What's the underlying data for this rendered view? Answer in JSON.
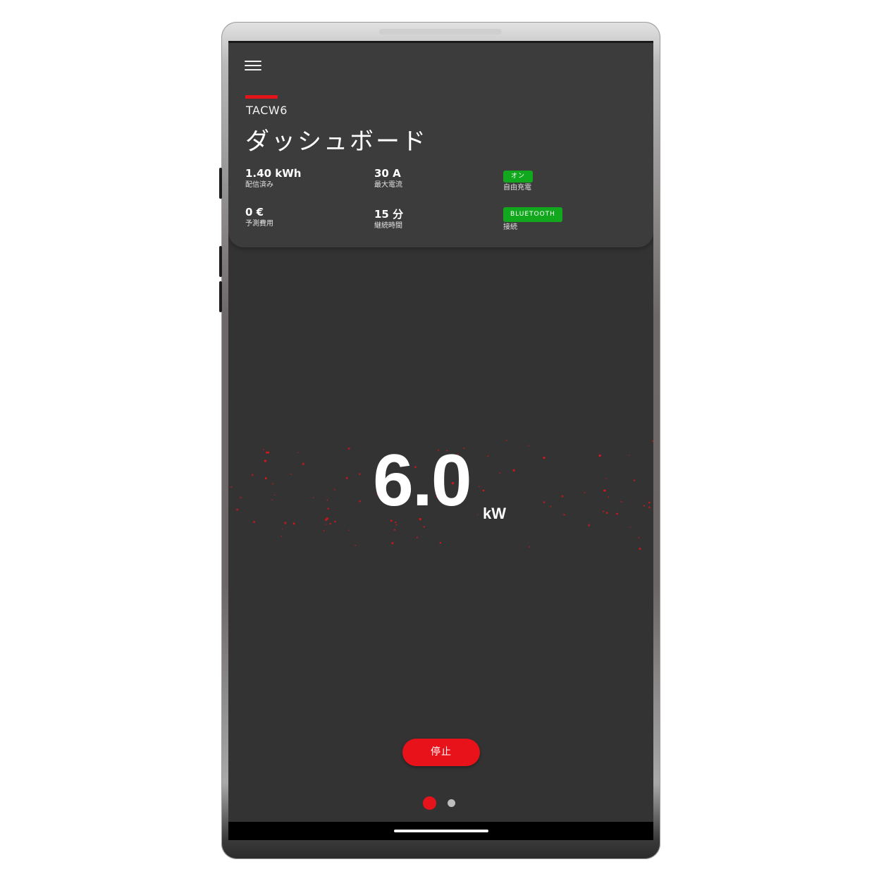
{
  "colors": {
    "accent": "#e5141b",
    "status_green": "#12a81d",
    "screen_bg": "#333333",
    "card_bg": "#3c3c3c",
    "particle": "#e0141b",
    "dot_inactive": "#bdbdbd"
  },
  "header": {
    "menu_icon": "hamburger-menu-icon",
    "device_name": "TACW6",
    "title": "ダッシュボード"
  },
  "stats": {
    "delivered": {
      "value": "1.40 kWh",
      "label": "配信済み"
    },
    "max_current": {
      "value": "30 A",
      "label": "最大電流"
    },
    "free_charge": {
      "badge": "オン",
      "label": "自由充電"
    },
    "estimated_cost": {
      "value": "0 €",
      "label": "予測費用"
    },
    "duration": {
      "value": "15 分",
      "label": "継続時間"
    },
    "connection": {
      "badge": "BLUETOOTH",
      "label": "接続"
    }
  },
  "power": {
    "value": "6.0",
    "unit": "kW"
  },
  "actions": {
    "stop_label": "停止"
  },
  "pager": {
    "total": 2,
    "active": 1
  }
}
